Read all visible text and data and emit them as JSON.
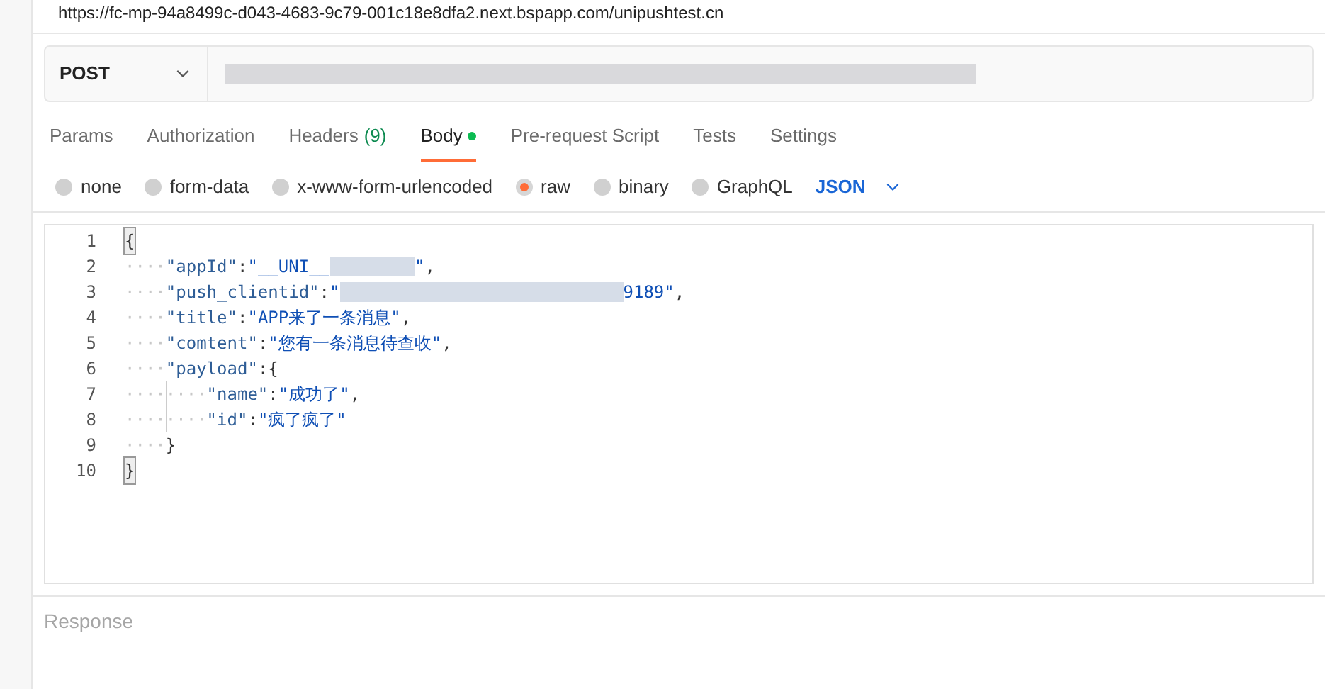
{
  "url_title": "https://fc-mp-94a8499c-d043-4683-9c79-001c18e8dfa2.next.bspapp.com/unipushtest.cn",
  "request": {
    "method": "POST"
  },
  "tabs": [
    {
      "label": "Params",
      "selected": false
    },
    {
      "label": "Authorization",
      "selected": false
    },
    {
      "label": "Headers",
      "count": "(9)",
      "selected": false
    },
    {
      "label": "Body",
      "selected": true,
      "dot": true
    },
    {
      "label": "Pre-request Script",
      "selected": false
    },
    {
      "label": "Tests",
      "selected": false
    },
    {
      "label": "Settings",
      "selected": false
    }
  ],
  "body_types": [
    {
      "label": "none",
      "selected": false
    },
    {
      "label": "form-data",
      "selected": false
    },
    {
      "label": "x-www-form-urlencoded",
      "selected": false
    },
    {
      "label": "raw",
      "selected": true
    },
    {
      "label": "binary",
      "selected": false
    },
    {
      "label": "GraphQL",
      "selected": false
    }
  ],
  "format": "JSON",
  "editor": {
    "lines": [
      {
        "number": "1",
        "tokens": [
          {
            "kind": "brace",
            "text": "{"
          }
        ]
      },
      {
        "number": "2",
        "whitespace": "····",
        "tokens": [
          {
            "kind": "key",
            "text": "\"appId\""
          },
          {
            "kind": "punct",
            "text": ":"
          },
          {
            "kind": "string",
            "text": "\"__UNI__"
          },
          {
            "kind": "redacted"
          },
          {
            "kind": "string",
            "text": "\""
          },
          {
            "kind": "punct",
            "text": ","
          }
        ]
      },
      {
        "number": "3",
        "whitespace": "····",
        "tokens": [
          {
            "kind": "key",
            "text": "\"push_clientid\""
          },
          {
            "kind": "punct",
            "text": ":"
          },
          {
            "kind": "string",
            "text": "\""
          },
          {
            "kind": "redacted"
          },
          {
            "kind": "string",
            "text": "9189\""
          },
          {
            "kind": "punct",
            "text": ","
          }
        ]
      },
      {
        "number": "4",
        "whitespace": "····",
        "tokens": [
          {
            "kind": "key",
            "text": "\"title\""
          },
          {
            "kind": "punct",
            "text": ":"
          },
          {
            "kind": "string",
            "text": "\"APP来了一条消息\""
          },
          {
            "kind": "punct",
            "text": ","
          }
        ]
      },
      {
        "number": "5",
        "whitespace": "····",
        "tokens": [
          {
            "kind": "key",
            "text": "\"comtent\""
          },
          {
            "kind": "punct",
            "text": ":"
          },
          {
            "kind": "string",
            "text": "\"您有一条消息待查收\""
          },
          {
            "kind": "punct",
            "text": ","
          }
        ]
      },
      {
        "number": "6",
        "whitespace": "····",
        "tokens": [
          {
            "kind": "key",
            "text": "\"payload\""
          },
          {
            "kind": "punct",
            "text": ":"
          },
          {
            "kind": "punct",
            "text": "{"
          }
        ]
      },
      {
        "number": "7",
        "whitespace": "········",
        "tokens": [
          {
            "kind": "key",
            "text": "\"name\""
          },
          {
            "kind": "punct",
            "text": ":"
          },
          {
            "kind": "string",
            "text": "\"成功了\""
          },
          {
            "kind": "punct",
            "text": ","
          }
        ]
      },
      {
        "number": "8",
        "whitespace": "········",
        "tokens": [
          {
            "kind": "key",
            "text": "\"id\""
          },
          {
            "kind": "punct",
            "text": ":"
          },
          {
            "kind": "string",
            "text": "\"疯了疯了\""
          }
        ]
      },
      {
        "number": "9",
        "whitespace": "····",
        "tokens": [
          {
            "kind": "punct",
            "text": "}"
          }
        ]
      },
      {
        "number": "10",
        "tokens": [
          {
            "kind": "brace",
            "text": "}"
          }
        ]
      }
    ]
  },
  "response": {
    "label": "Response"
  }
}
